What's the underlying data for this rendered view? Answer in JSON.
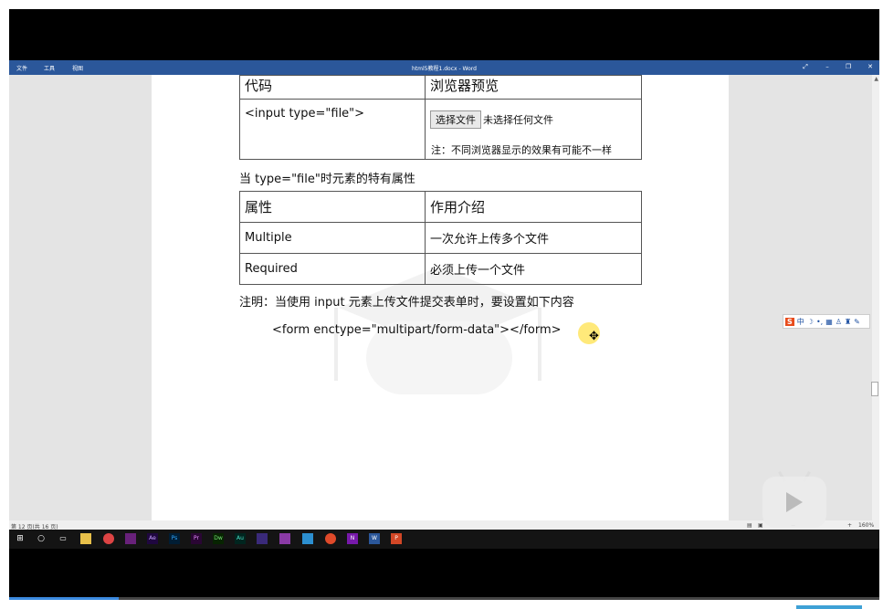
{
  "window": {
    "title": "html5教程1.docx - Word",
    "menus": [
      "文件",
      "工具",
      "视图"
    ]
  },
  "table1": {
    "headers": [
      "代码",
      "浏览器预览"
    ],
    "code": "<input type=\"file\">",
    "button_label": "选择文件",
    "file_status": "未选择任何文件",
    "note": "注：不同浏览器显示的效果有可能不一样"
  },
  "caption": "当 type=\"file\"时元素的特有属性",
  "table2": {
    "headers": [
      "属性",
      "作用介绍"
    ],
    "rows": [
      {
        "attr": "Multiple",
        "desc": "一次允许上传多个文件"
      },
      {
        "attr": "Required",
        "desc": "必须上传一个文件"
      }
    ]
  },
  "note": "注明：当使用 input 元素上传文件提交表单时，要设置如下内容",
  "form_code": "<form enctype=\"multipart/form-data\"></form>",
  "status": {
    "page": "第 12 页(共 16 页)",
    "zoom": "160%"
  },
  "ime": {
    "logo": "S",
    "mode": "中"
  },
  "taskbar_apps": [
    "windows-icon",
    "cortana-icon",
    "task-view-icon",
    "file-explorer-icon",
    "chrome-icon",
    "visual-studio-icon",
    "after-effects-icon",
    "photoshop-icon",
    "premiere-icon",
    "dreamweaver-icon",
    "audition-icon",
    "app-icon",
    "app-icon",
    "app-icon",
    "app-icon",
    "onenote-icon",
    "word-icon",
    "powerpoint-icon"
  ],
  "colors": {
    "titlebar": "#2b579a",
    "taskbar": "#141414",
    "cursor_highlight": "#ffe97a",
    "ime_logo": "#e84c1c"
  }
}
